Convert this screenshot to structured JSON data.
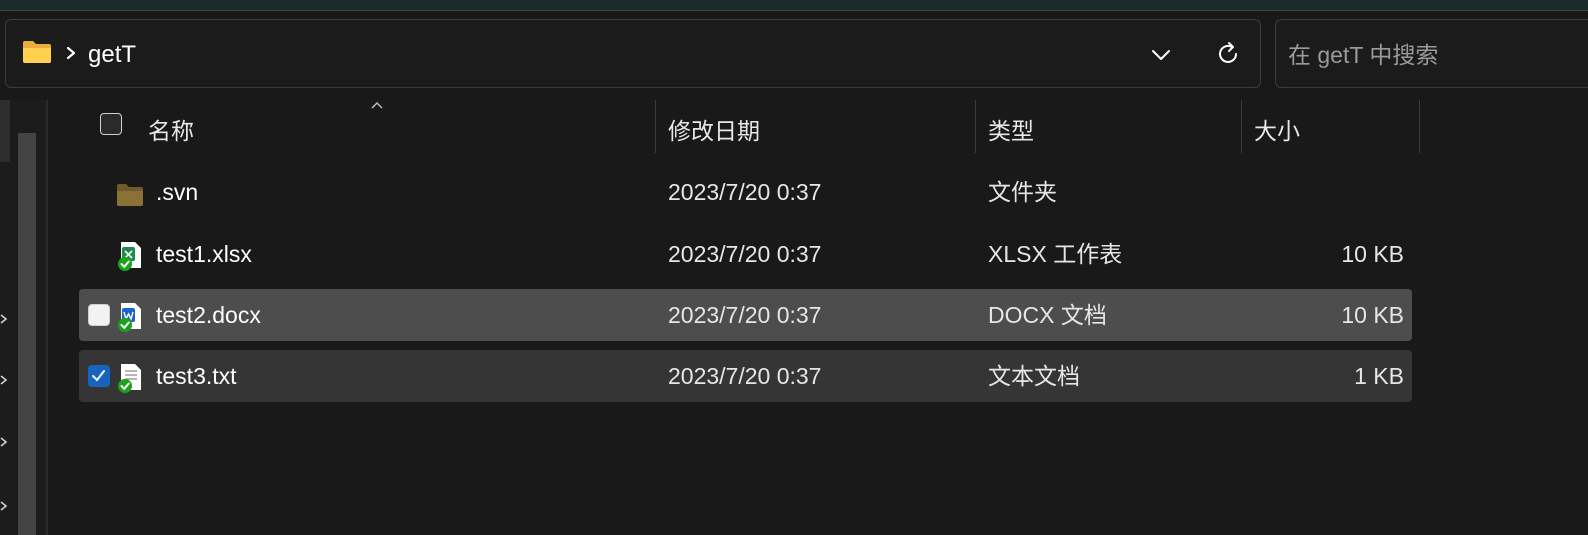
{
  "address_bar": {
    "path": [
      "getT"
    ],
    "folder_icon": "folder-icon",
    "dropdown_icon": "chevron-down-icon",
    "refresh_icon": "refresh-icon"
  },
  "search": {
    "placeholder": "在 getT 中搜索",
    "value": ""
  },
  "columns": {
    "name": "名称",
    "modified": "修改日期",
    "type": "类型",
    "size": "大小"
  },
  "files": [
    {
      "name": ".svn",
      "modified": "2023/7/20 0:37",
      "type": "文件夹",
      "size": "",
      "icon": "folder-icon",
      "state": "normal",
      "checked": false
    },
    {
      "name": "test1.xlsx",
      "modified": "2023/7/20 0:37",
      "type": "XLSX 工作表",
      "size": "10 KB",
      "icon": "xlsx-svn-ok-icon",
      "state": "normal",
      "checked": false
    },
    {
      "name": "test2.docx",
      "modified": "2023/7/20 0:37",
      "type": "DOCX 文档",
      "size": "10 KB",
      "icon": "docx-svn-ok-icon",
      "state": "hover",
      "checked": false
    },
    {
      "name": "test3.txt",
      "modified": "2023/7/20 0:37",
      "type": "文本文档",
      "size": "1 KB",
      "icon": "txt-svn-ok-icon",
      "state": "selected",
      "checked": true
    }
  ],
  "colors": {
    "background": "#191919",
    "hover_row": "#4d4d4d",
    "selected_row": "#353535",
    "checkbox_checked": "#1565c0",
    "svn_ok_badge": "#1aa31a"
  }
}
